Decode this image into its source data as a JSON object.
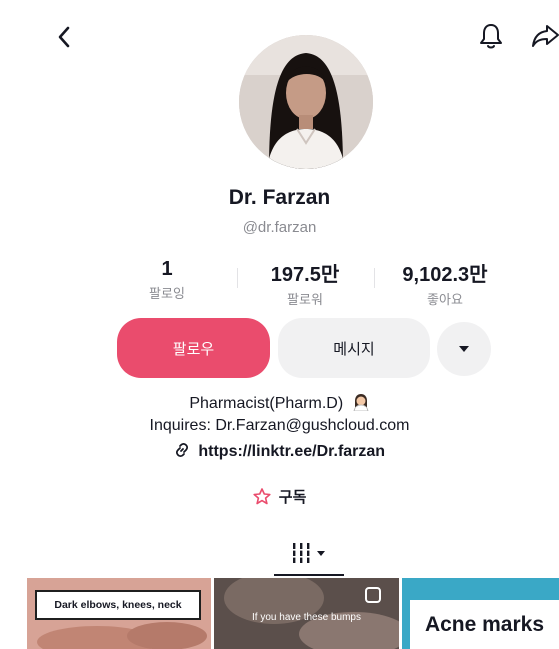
{
  "header": {
    "back_icon": "chevron-left-icon",
    "bell_icon": "bell-icon",
    "share_icon": "share-icon"
  },
  "profile": {
    "name": "Dr. Farzan",
    "handle": "@dr.farzan"
  },
  "stats": [
    {
      "value": "1",
      "label": "팔로잉"
    },
    {
      "value": "197.5만",
      "label": "팔로워"
    },
    {
      "value": "9,102.3만",
      "label": "좋아요"
    }
  ],
  "actions": {
    "follow_label": "팔로우",
    "message_label": "메시지",
    "more_icon": "caret-down-icon"
  },
  "bio": {
    "line1": "Pharmacist(Pharm.D)",
    "line2": "Inquires: Dr.Farzan@gushcloud.com",
    "link": "https://linktr.ee/Dr.farzan"
  },
  "subscribe": {
    "label": "구독",
    "icon": "star-icon"
  },
  "tab": {
    "icon": "grid-icon"
  },
  "thumbnails": [
    {
      "caption": "Dark elbows, knees, neck"
    },
    {
      "caption": "If you have these bumps"
    },
    {
      "caption": "Acne marks"
    }
  ],
  "colors": {
    "accent": "#ea4c6d",
    "muted": "#8a8b91",
    "text": "#161823"
  }
}
